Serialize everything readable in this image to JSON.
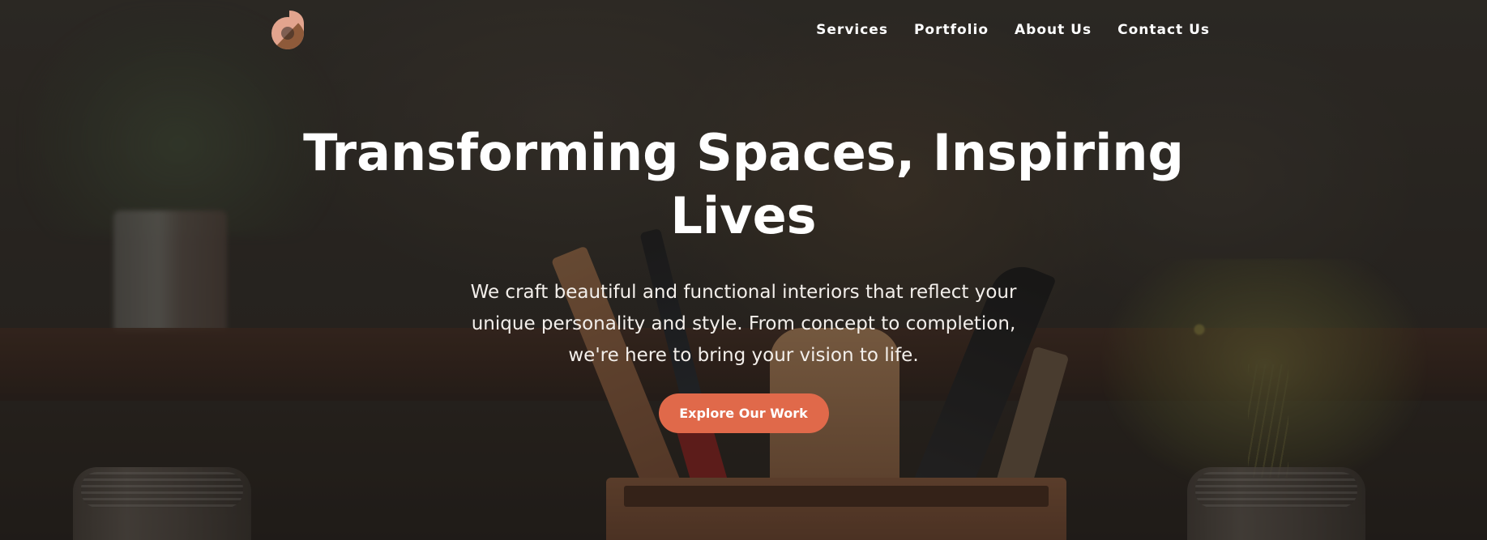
{
  "brand": {
    "logo_icon": "g-monogram-logo",
    "colors": {
      "logo_top": "#e2a48e",
      "logo_bottom": "#8e5a3a",
      "accent": "#e0694a",
      "text": "#ffffff"
    }
  },
  "nav": {
    "items": [
      {
        "label": "Services"
      },
      {
        "label": "Portfolio"
      },
      {
        "label": "About Us"
      },
      {
        "label": "Contact Us"
      }
    ]
  },
  "hero": {
    "title": "Transforming Spaces, Inspiring Lives",
    "subtitle": "We craft beautiful and functional interiors that reflect your unique personality and style. From concept to completion, we're here to bring your vision to life.",
    "cta_label": "Explore Our Work"
  }
}
